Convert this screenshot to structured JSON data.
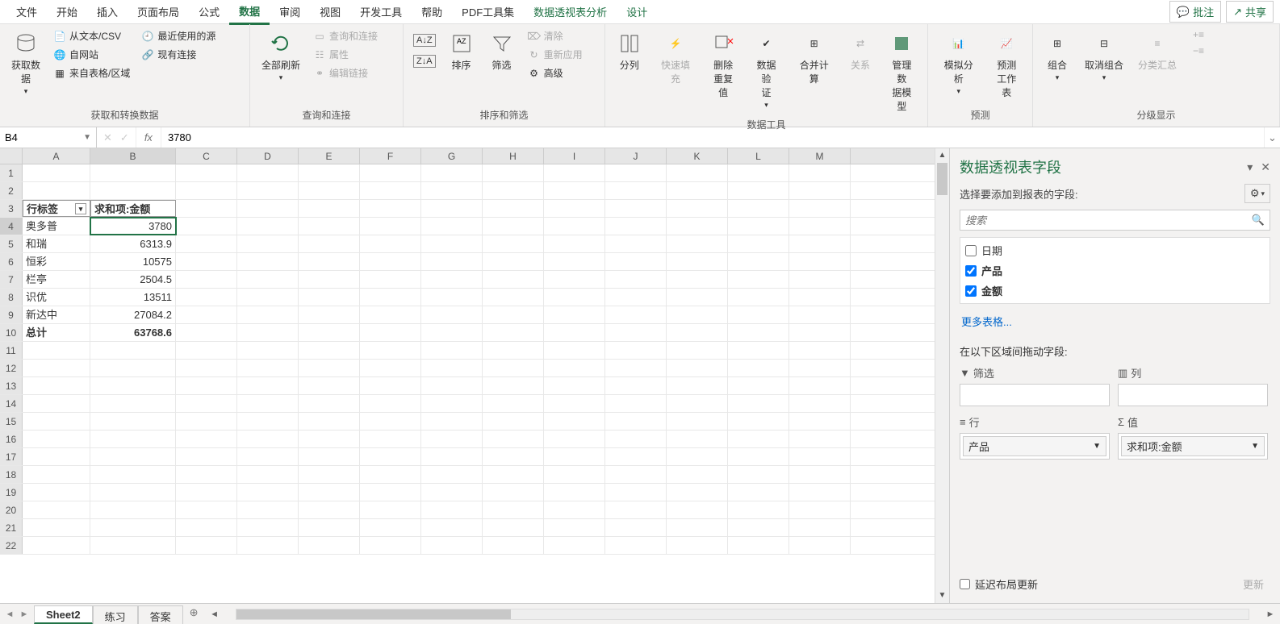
{
  "menu": {
    "tabs": [
      "文件",
      "开始",
      "插入",
      "页面布局",
      "公式",
      "数据",
      "审阅",
      "视图",
      "开发工具",
      "帮助",
      "PDF工具集",
      "数据透视表分析",
      "设计"
    ],
    "active_index": 5,
    "comment": "批注",
    "share": "共享"
  },
  "ribbon": {
    "g1": {
      "label": "获取和转换数据",
      "getdata": "获取数\n据",
      "csv": "从文本/CSV",
      "web": "自网站",
      "table": "来自表格/区域",
      "recent": "最近使用的源",
      "existing": "现有连接"
    },
    "g2": {
      "label": "查询和连接",
      "refresh": "全部刷新",
      "conn": "查询和连接",
      "prop": "属性",
      "links": "编辑链接"
    },
    "g3": {
      "label": "排序和筛选",
      "sort": "排序",
      "filter": "筛选",
      "clear": "清除",
      "reapply": "重新应用",
      "advanced": "高级"
    },
    "g4": {
      "label": "数据工具",
      "split": "分列",
      "flash": "快速填充",
      "dedup": "删除\n重复值",
      "valid": "数据验\n证",
      "consol": "合并计算",
      "rel": "关系",
      "model": "管理数\n据模型"
    },
    "g5": {
      "label": "预测",
      "whatif": "模拟分析",
      "forecast": "预测\n工作表"
    },
    "g6": {
      "label": "分级显示",
      "group": "组合",
      "ungroup": "取消组合",
      "subtotal": "分类汇总"
    }
  },
  "formula": {
    "cellref": "B4",
    "value": "3780",
    "fx": "fx"
  },
  "cols": [
    "A",
    "B",
    "C",
    "D",
    "E",
    "F",
    "G",
    "H",
    "I",
    "J",
    "K",
    "L",
    "M"
  ],
  "pivot": {
    "rowlabel": "行标签",
    "sumlabel": "求和项:金额",
    "total": "总计",
    "rows": [
      {
        "k": "奥多普",
        "v": "3780"
      },
      {
        "k": "和瑞",
        "v": "6313.9"
      },
      {
        "k": "恒彩",
        "v": "10575"
      },
      {
        "k": "栏亭",
        "v": "2504.5"
      },
      {
        "k": "识优",
        "v": "13511"
      },
      {
        "k": "新达中",
        "v": "27084.2"
      }
    ],
    "totalv": "63768.6"
  },
  "pane": {
    "title": "数据透视表字段",
    "choose": "选择要添加到报表的字段:",
    "search": "搜索",
    "fields": [
      {
        "name": "日期",
        "checked": false
      },
      {
        "name": "产品",
        "checked": true
      },
      {
        "name": "金额",
        "checked": true
      }
    ],
    "more": "更多表格...",
    "draglabel": "在以下区域间拖动字段:",
    "areas": {
      "filter": "筛选",
      "columns": "列",
      "rows": "行",
      "values": "值"
    },
    "rowitem": "产品",
    "valitem": "求和项:金额",
    "defer": "延迟布局更新",
    "update": "更新"
  },
  "sheets": {
    "s1": "Sheet2",
    "s2": "练习",
    "s3": "答案"
  }
}
